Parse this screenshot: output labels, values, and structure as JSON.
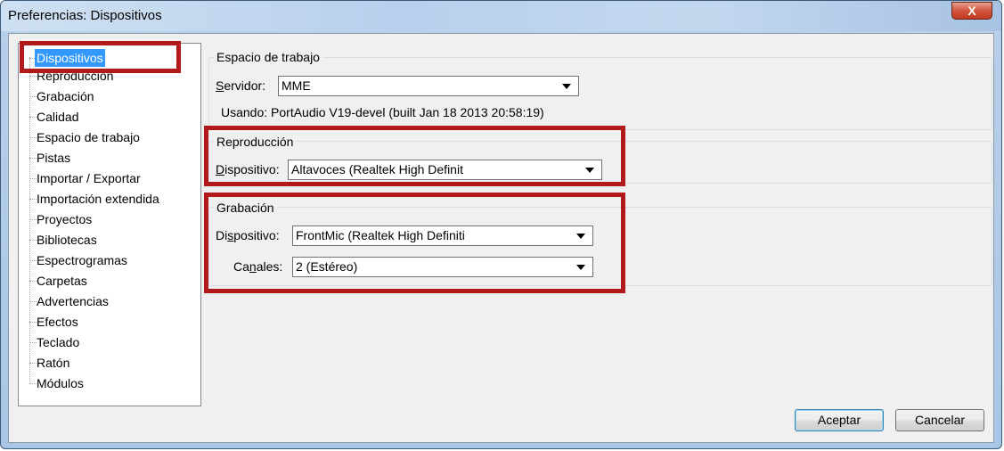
{
  "window": {
    "title": "Preferencias: Dispositivos",
    "close_label": "X"
  },
  "tree": {
    "items": [
      "Dispositivos",
      "Reproducción",
      "Grabación",
      "Calidad",
      "Espacio de trabajo",
      "Pistas",
      "Importar / Exportar",
      "Importación extendida",
      "Proyectos",
      "Bibliotecas",
      "Espectrogramas",
      "Carpetas",
      "Advertencias",
      "Efectos",
      "Teclado",
      "Ratón",
      "Módulos"
    ],
    "selected": "Dispositivos"
  },
  "workspace": {
    "title": "Espacio de trabajo",
    "server_label_pre": "",
    "server_label_mnemonic": "S",
    "server_label_post": "ervidor:",
    "server_value": "MME",
    "using_text": "Usando: PortAudio V19-devel (built Jan 18 2013 20:58:19)"
  },
  "playback": {
    "title": "Reproducción",
    "device_label_mnemonic": "D",
    "device_label_post": "ispositivo:",
    "device_value": "Altavoces (Realtek High Definit"
  },
  "recording": {
    "title": "Grabación",
    "device_label_pre": "Di",
    "device_label_mnemonic": "s",
    "device_label_post": "positivo:",
    "device_value": "FrontMic (Realtek High Definiti",
    "channels_label_pre": "Ca",
    "channels_label_mnemonic": "n",
    "channels_label_post": "ales:",
    "channels_value": "2 (Estéreo)"
  },
  "buttons": {
    "ok": "Aceptar",
    "cancel": "Cancelar"
  },
  "colors": {
    "highlight": "#b01a1a",
    "selection": "#3399ff"
  }
}
